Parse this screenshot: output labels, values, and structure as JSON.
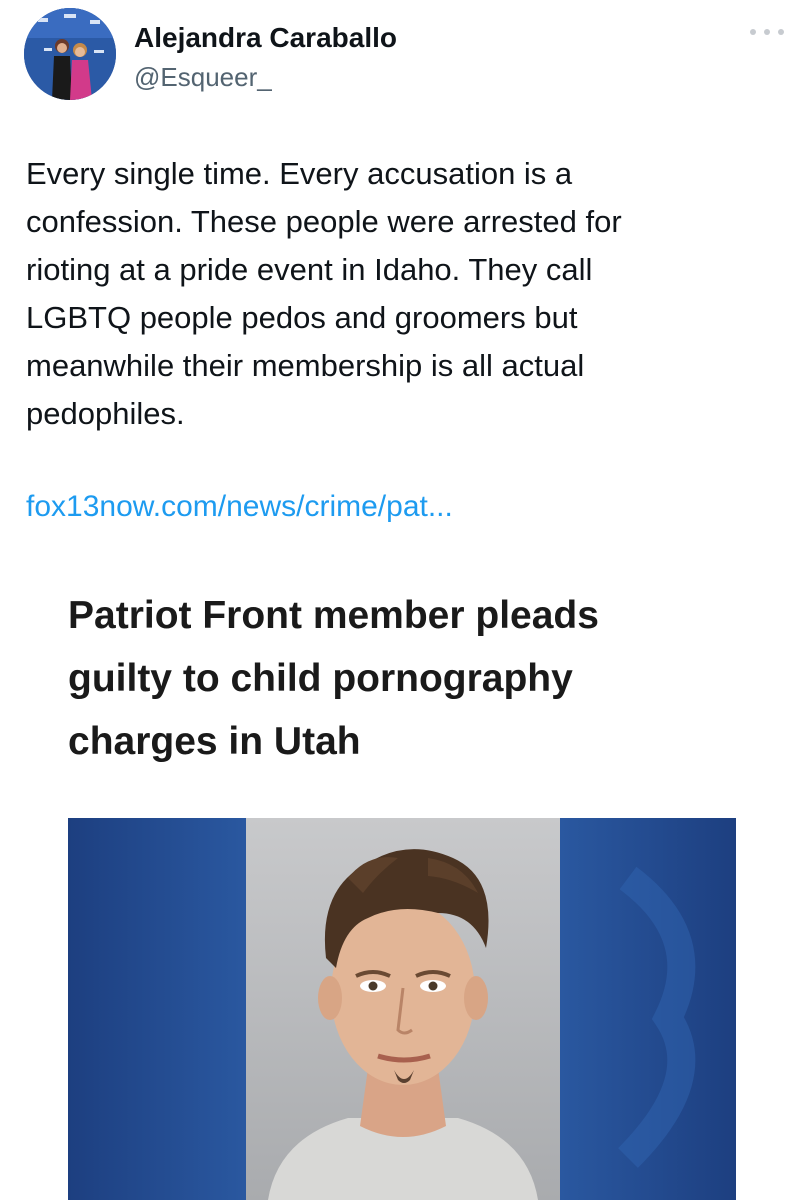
{
  "tweet": {
    "author": {
      "display_name": "Alejandra Caraballo",
      "handle": "@Esqueer_",
      "avatar_icon": "profile-photo"
    },
    "more_icon": "more-horizontal-icon",
    "text": "Every single time. Every accusation is a\nconfession. These people were arrested for\nrioting at a pride event in Idaho. They call\nLGBTQ people pedos and groomers but\nmeanwhile their membership is all actual\npedophiles.",
    "link_text": "fox13now.com/news/crime/pat...",
    "link_color": "#1d9bf0"
  },
  "article": {
    "headline": "Patriot Front member pleads\nguilty to child pornography\ncharges in Utah",
    "image_icon": "mugshot-photo"
  }
}
